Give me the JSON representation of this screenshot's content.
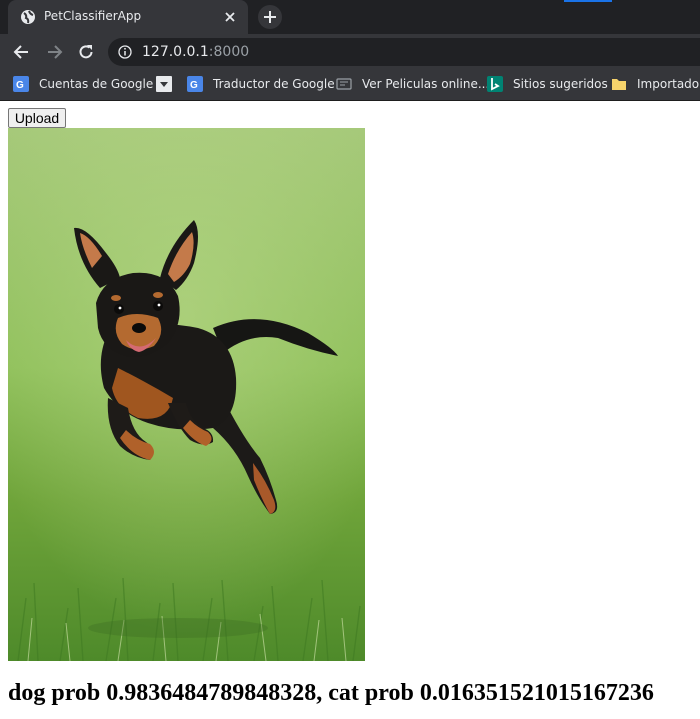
{
  "browser": {
    "tab_title": "PetClassifierApp",
    "url_host": "127.0.0.1",
    "url_port": ":8000",
    "bookmarks": [
      {
        "label": "Cuentas de Google",
        "icon": "google-icon"
      },
      {
        "label": "",
        "icon": "dropdown-bookmark-icon"
      },
      {
        "label": "Traductor de Google",
        "icon": "google-translate-icon"
      },
      {
        "label": "Ver Peliculas online...",
        "icon": "movie-icon"
      },
      {
        "label": "Sitios sugeridos",
        "icon": "bing-icon"
      },
      {
        "label": "Importado d",
        "icon": "folder-icon"
      }
    ]
  },
  "page": {
    "upload_label": "Upload",
    "result_text": "dog prob 0.9836484789848328, cat prob 0.01635152101516723​6",
    "image_alt": "Small black and tan dog running on grass"
  },
  "colors": {
    "tabstrip": "#202124",
    "toolbar": "#35363a",
    "grass_light": "#9cc56a",
    "grass_dark": "#4f8a2a"
  }
}
